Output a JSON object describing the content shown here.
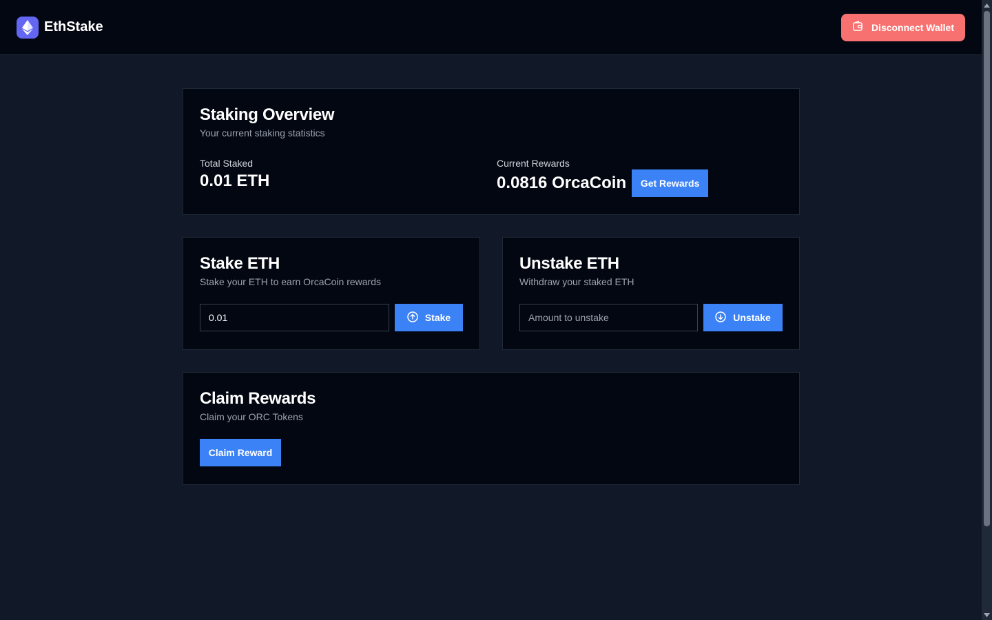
{
  "header": {
    "brand": "EthStake",
    "disconnect_label": "Disconnect Wallet"
  },
  "overview": {
    "title": "Staking Overview",
    "subtitle": "Your current staking statistics",
    "total_staked_label": "Total Staked",
    "total_staked_value": "0.01 ETH",
    "current_rewards_label": "Current Rewards",
    "current_rewards_value": "0.0816 OrcaCoin",
    "get_rewards_label": "Get Rewards"
  },
  "stake": {
    "title": "Stake ETH",
    "subtitle": "Stake your ETH to earn OrcaCoin rewards",
    "input_value": "0.01",
    "button_label": "Stake"
  },
  "unstake": {
    "title": "Unstake ETH",
    "subtitle": "Withdraw your staked ETH",
    "input_placeholder": "Amount to unstake",
    "button_label": "Unstake"
  },
  "claim": {
    "title": "Claim Rewards",
    "subtitle": "Claim your ORC Tokens",
    "button_label": "Claim Reward"
  },
  "colors": {
    "accent": "#3b82f6",
    "danger": "#f87171",
    "background": "#111827",
    "card": "#030712"
  },
  "icons": {
    "brand": "ethereum-icon",
    "disconnect": "wallet-icon",
    "stake": "arrow-up-circle-icon",
    "unstake": "arrow-down-circle-icon"
  }
}
